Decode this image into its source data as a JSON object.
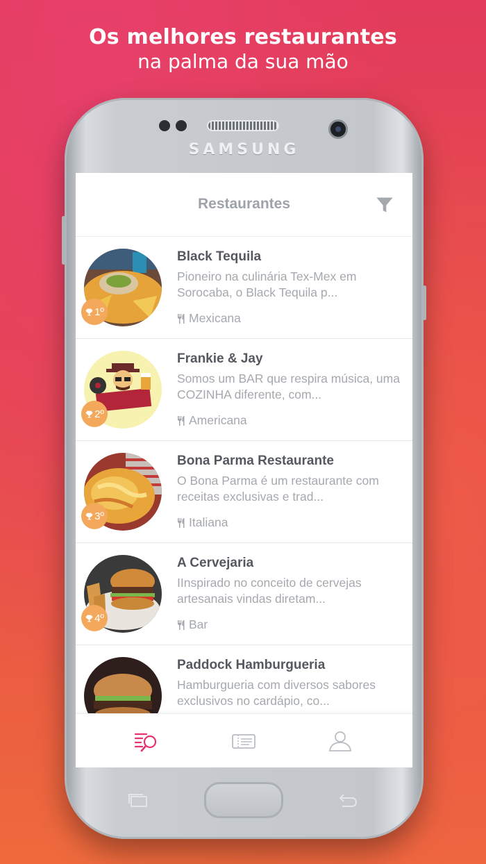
{
  "headline": {
    "line1": "Os melhores restaurantes",
    "line2": "na palma da sua mão"
  },
  "device": {
    "brand": "SAMSUNG"
  },
  "appbar": {
    "title": "Restaurantes",
    "filter_icon": "filter-icon"
  },
  "restaurants": [
    {
      "name": "Black Tequila",
      "description": "Pioneiro na culinária Tex-Mex em Sorocaba, o Black Tequila p...",
      "cuisine": "Mexicana",
      "rank": "1º"
    },
    {
      "name": "Frankie & Jay",
      "description": "Somos um BAR que respira música, uma COZINHA diferente, com...",
      "cuisine": "Americana",
      "rank": "2º"
    },
    {
      "name": "Bona Parma Restaurante",
      "description": "O Bona Parma é um restaurante com receitas exclusivas e trad...",
      "cuisine": "Italiana",
      "rank": "3º"
    },
    {
      "name": "A Cervejaria",
      "description": "IInspirado no conceito de cervejas artesanais vindas diretam...",
      "cuisine": "Bar",
      "rank": "4º"
    },
    {
      "name": "Paddock Hamburgueria",
      "description": "Hamburgueria com diversos sabores exclusivos no cardápio, co...",
      "cuisine": "",
      "rank": ""
    }
  ],
  "tabs": [
    {
      "icon": "search-list-icon",
      "active": true
    },
    {
      "icon": "ticket-icon",
      "active": false
    },
    {
      "icon": "user-icon",
      "active": false
    }
  ],
  "colors": {
    "accent": "#e8336e",
    "rank_badge": "#f3a85b",
    "muted_text": "#a5a9ae"
  }
}
